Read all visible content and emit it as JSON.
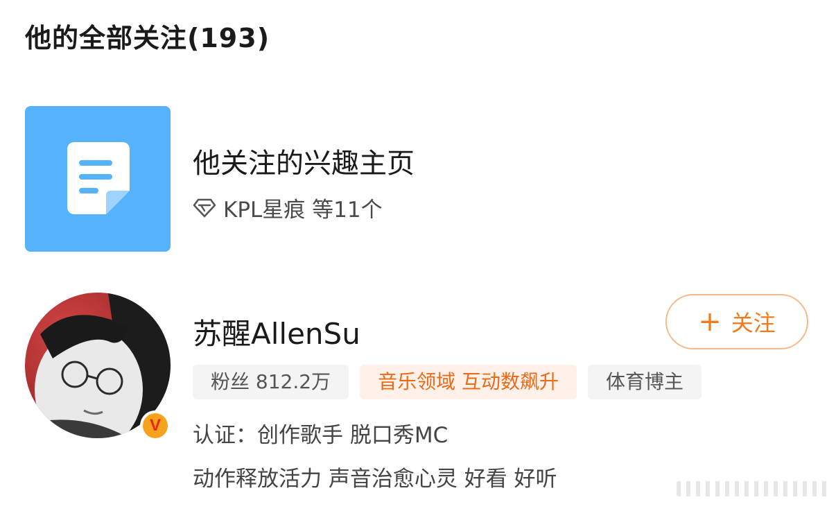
{
  "header": {
    "title": "他的全部关注(193)"
  },
  "interest": {
    "title": "他关注的兴趣主页",
    "subtitle": "KPL星痕 等11个",
    "icon": "document-icon",
    "subtitle_icon": "diamond-icon",
    "thumb_color": "#55b3fb"
  },
  "user": {
    "name": "苏醒AllenSu",
    "follow_label": "关注",
    "follow_color": "#f07a1e",
    "badge": "V",
    "tags": [
      "粉丝 812.2万",
      "音乐领域 互动数飙升",
      "体育博主"
    ],
    "verification": "认证：创作歌手 脱口秀MC",
    "description": "动作释放活力 声音治愈心灵 好看 好听"
  }
}
